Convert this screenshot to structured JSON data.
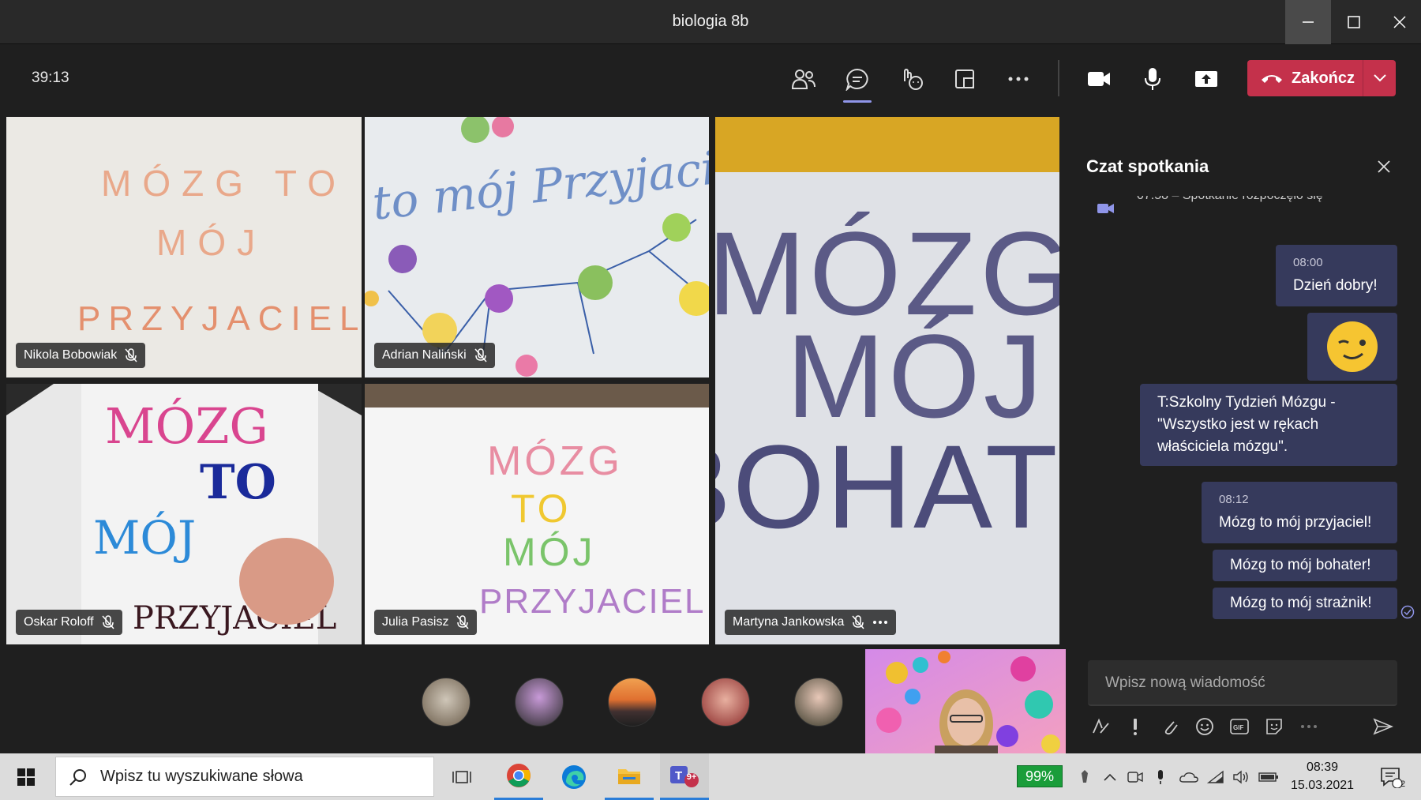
{
  "window": {
    "title": "biologia 8b",
    "minimize": "minimize-button",
    "maximize": "maximize-button",
    "close": "close-button"
  },
  "toolbar": {
    "timer": "39:13",
    "end_label": "Zakończ",
    "icons": [
      "participants-icon",
      "chat-icon",
      "reactions-icon",
      "rooms-icon",
      "more-icon",
      "camera-icon",
      "microphone-icon",
      "share-icon"
    ]
  },
  "tiles": [
    {
      "name": "Nikola Bobowiak",
      "sign": [
        "MÓZG TO",
        "MÓJ",
        "PRZYJACIEL"
      ],
      "muted": true
    },
    {
      "name": "Adrian Naliński",
      "sign": [
        "to mój Przyjaciel"
      ],
      "muted": true
    },
    {
      "name": "Martyna Jankowska",
      "sign": [
        "MÓZG TO",
        "MÓJ",
        "BOHATER"
      ],
      "muted": true
    },
    {
      "name": "Oskar Roloff",
      "sign": [
        "MÓZG",
        "TO",
        "MÓJ",
        "PRZYJACIEL"
      ],
      "muted": true
    },
    {
      "name": "Julia Pasisz",
      "sign": [
        "MÓZG",
        "TO",
        "MÓJ",
        "PRZYJACIEL"
      ],
      "muted": true
    }
  ],
  "chat": {
    "title": "Czat spotkania",
    "system": {
      "time": "07:58",
      "text": "Spotkanie rozpoczęło się"
    },
    "messages": [
      {
        "time": "08:00",
        "text": "Dzień dobry!"
      },
      {
        "text": "T:Szkolny Tydzień Mózgu - \"Wszystko jest w rękach właściciela mózgu\"."
      },
      {
        "time": "08:12",
        "text": "Mózg to mój przyjaciel!"
      },
      {
        "text": "Mózg to mój bohater!"
      },
      {
        "text": "Mózg to mój strażnik!"
      }
    ],
    "compose_placeholder": "Wpisz nową wiadomość"
  },
  "taskbar": {
    "search_placeholder": "Wpisz tu wyszukiwane słowa",
    "battery": "99%",
    "time": "08:39",
    "date": "15.03.2021",
    "notifications": "2",
    "teams_badge": "9+"
  },
  "colors": {
    "accent": "#8f95e8",
    "end_call": "#c4314b",
    "bubble": "#363a5c",
    "battery": "#1a9d3a"
  }
}
